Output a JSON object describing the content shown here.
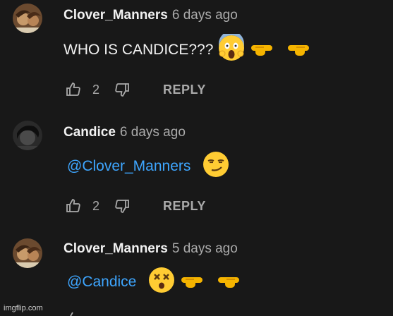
{
  "comments": [
    {
      "author": "Clover_Manners",
      "age": "6 days ago",
      "text": "WHO IS CANDICE???",
      "mention": "",
      "emoji_icons": [
        "face-screaming-in-fear-icon",
        "pointing-right-icon",
        "pointing-left-icon"
      ],
      "likes": "2",
      "reply_label": "REPLY"
    },
    {
      "author": "Candice",
      "age": "6 days ago",
      "text": "",
      "mention": "@Clover_Manners",
      "emoji_icons": [
        "smirking-face-icon"
      ],
      "likes": "2",
      "reply_label": "REPLY"
    },
    {
      "author": "Clover_Manners",
      "age": "5 days ago",
      "text": "",
      "mention": "@Candice",
      "emoji_icons": [
        "dizzy-face-icon",
        "pointing-right-icon",
        "pointing-left-icon"
      ],
      "likes": "",
      "reply_label": ""
    }
  ],
  "watermark": "imgflip.com",
  "colors": {
    "background": "#181818",
    "text": "#f1f1f1",
    "muted": "#aaaaaa",
    "mention": "#3ea6ff",
    "emoji": "#ffcc33"
  }
}
